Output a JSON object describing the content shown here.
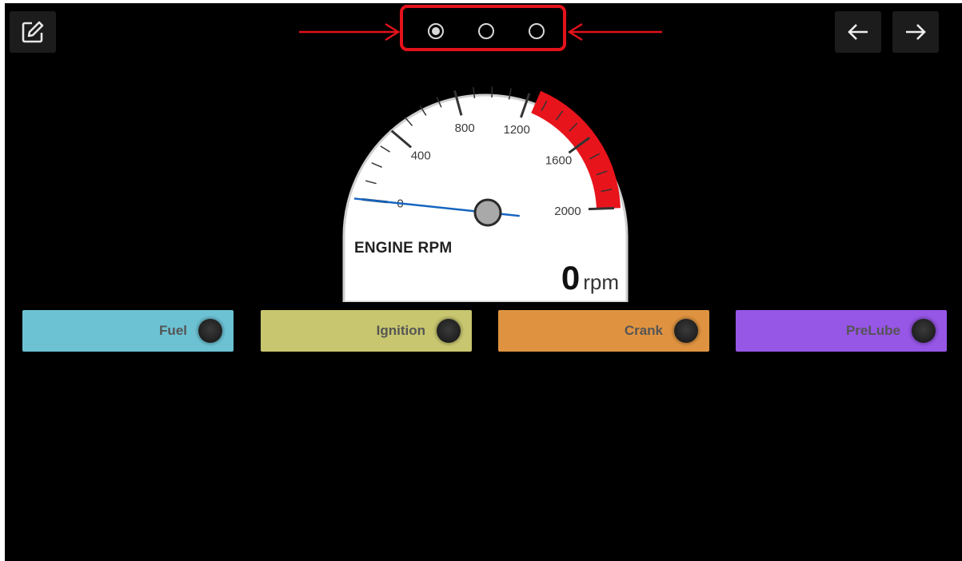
{
  "toolbar": {
    "edit_icon": "edit-pencil-square-icon",
    "back_icon": "arrow-left-icon",
    "forward_icon": "arrow-right-icon"
  },
  "pager": {
    "pages": 3,
    "current": 1
  },
  "gauge": {
    "title": "ENGINE RPM",
    "value": "0",
    "unit": "rpm",
    "min": 0,
    "max": 2000,
    "redline_start": 1250,
    "tick_labels": [
      "0",
      "400",
      "800",
      "1200",
      "1600",
      "2000"
    ]
  },
  "controls": [
    {
      "label": "Fuel",
      "color": "#6cc2d3"
    },
    {
      "label": "Ignition",
      "color": "#c8c66f"
    },
    {
      "label": "Crank",
      "color": "#df9340"
    },
    {
      "label": "PreLube",
      "color": "#9656e6"
    }
  ],
  "colors": {
    "background": "#000000",
    "annotation": "#e3121b",
    "redline": "#e8141c",
    "needle": "#1565c0"
  }
}
